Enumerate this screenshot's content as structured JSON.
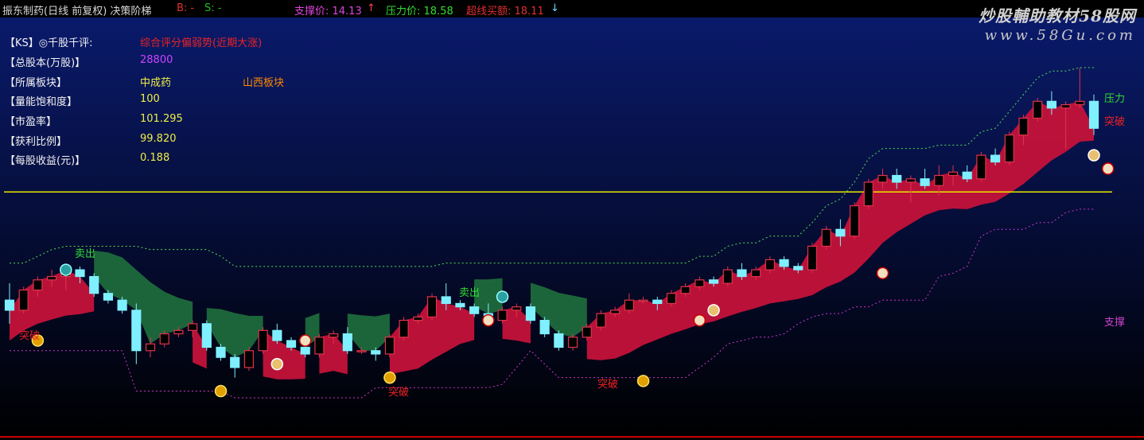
{
  "header": {
    "title": "振东制药(日线 前复权) 决策阶梯",
    "b_label": "B: -",
    "s_label": "S: -",
    "support": "支撑价: 14.13",
    "resistance": "压力价: 18.58",
    "breakout": "超线买额: 18.11",
    "up_arrow": "↑",
    "down_arrow": "↓"
  },
  "watermark": {
    "line1": "炒股輔助教材58股网",
    "line2": "www.58Gu.com"
  },
  "info": {
    "rows": [
      {
        "label": "【KS】◎千股千评:",
        "value": "综合评分偏弱势(近期大涨)",
        "extra": ""
      },
      {
        "label": "【总股本(万股)】",
        "value": "28800",
        "extra": ""
      },
      {
        "label": "【所属板块】",
        "value": "中成药",
        "extra": "山西板块"
      },
      {
        "label": "【量能饱和度】",
        "value": "100",
        "extra": ""
      },
      {
        "label": "【市盈率】",
        "value": "101.295",
        "extra": ""
      },
      {
        "label": "【获利比例】",
        "value": "99.820",
        "extra": ""
      },
      {
        "label": "【每股收益(元)】",
        "value": "0.188",
        "extra": ""
      }
    ]
  },
  "annotations": {
    "sell": "卖出",
    "support": "支撑",
    "resistance": "压力",
    "surge": "突破"
  },
  "colors": {
    "background_top": "#0a1a6b",
    "background_bottom": "#000000",
    "up_candle": "#e0334a",
    "down_candle": "#7ff0ff",
    "bull_band": "#c4123a",
    "bear_band": "#1e6a3c",
    "level_line": "#e8e800",
    "resist_dots": "#55dd55",
    "support_dots": "#cc33cc"
  },
  "chart_data": {
    "type": "candlestick",
    "candles": [
      [
        14.9,
        15.4,
        14.2,
        14.6
      ],
      [
        14.6,
        15.3,
        14.5,
        15.2
      ],
      [
        15.2,
        15.6,
        15.0,
        15.5
      ],
      [
        15.5,
        15.8,
        15.3,
        15.6
      ],
      [
        15.6,
        15.9,
        15.2,
        15.8
      ],
      [
        15.8,
        15.9,
        15.4,
        15.6
      ],
      [
        15.6,
        15.7,
        15.0,
        15.1
      ],
      [
        15.1,
        15.2,
        14.8,
        14.9
      ],
      [
        14.9,
        15.0,
        14.5,
        14.6
      ],
      [
        14.6,
        14.8,
        13.0,
        13.4
      ],
      [
        13.4,
        13.8,
        13.2,
        13.6
      ],
      [
        13.6,
        14.0,
        13.5,
        13.9
      ],
      [
        13.9,
        14.1,
        13.8,
        14.0
      ],
      [
        14.0,
        14.3,
        13.8,
        14.2
      ],
      [
        14.2,
        14.3,
        13.4,
        13.5
      ],
      [
        13.5,
        13.6,
        13.1,
        13.2
      ],
      [
        13.2,
        13.3,
        12.6,
        12.9
      ],
      [
        12.9,
        13.5,
        12.8,
        13.4
      ],
      [
        13.4,
        14.1,
        13.3,
        14.0
      ],
      [
        14.0,
        14.2,
        13.6,
        13.7
      ],
      [
        13.7,
        13.8,
        13.4,
        13.5
      ],
      [
        13.5,
        13.6,
        13.2,
        13.3
      ],
      [
        13.3,
        13.9,
        13.2,
        13.8
      ],
      [
        13.8,
        14.0,
        13.6,
        13.9
      ],
      [
        13.9,
        14.1,
        13.3,
        13.4
      ],
      [
        13.4,
        13.5,
        13.3,
        13.4
      ],
      [
        13.4,
        13.5,
        13.1,
        13.3
      ],
      [
        13.3,
        13.9,
        13.2,
        13.8
      ],
      [
        13.8,
        14.4,
        13.7,
        14.3
      ],
      [
        14.3,
        14.5,
        14.2,
        14.4
      ],
      [
        14.4,
        15.1,
        14.3,
        15.0
      ],
      [
        15.0,
        15.4,
        14.6,
        14.8
      ],
      [
        14.8,
        14.9,
        14.6,
        14.7
      ],
      [
        14.7,
        14.8,
        14.4,
        14.5
      ],
      [
        14.5,
        14.8,
        14.2,
        14.3
      ],
      [
        14.3,
        14.7,
        14.2,
        14.6
      ],
      [
        14.6,
        14.8,
        14.4,
        14.7
      ],
      [
        14.7,
        14.8,
        14.2,
        14.3
      ],
      [
        14.3,
        14.4,
        13.8,
        13.9
      ],
      [
        13.9,
        14.0,
        13.4,
        13.5
      ],
      [
        13.5,
        13.9,
        13.4,
        13.8
      ],
      [
        13.8,
        14.2,
        13.7,
        14.1
      ],
      [
        14.1,
        14.6,
        14.0,
        14.5
      ],
      [
        14.5,
        14.7,
        14.4,
        14.6
      ],
      [
        14.6,
        15.1,
        14.5,
        14.9
      ],
      [
        14.9,
        15.0,
        14.8,
        14.9
      ],
      [
        14.9,
        15.0,
        14.6,
        14.8
      ],
      [
        14.8,
        15.2,
        14.7,
        15.1
      ],
      [
        15.1,
        15.4,
        15.0,
        15.3
      ],
      [
        15.3,
        15.6,
        15.2,
        15.5
      ],
      [
        15.5,
        15.6,
        15.3,
        15.4
      ],
      [
        15.4,
        15.9,
        15.3,
        15.8
      ],
      [
        15.8,
        16.0,
        15.5,
        15.6
      ],
      [
        15.6,
        15.9,
        15.5,
        15.8
      ],
      [
        15.8,
        16.2,
        15.7,
        16.1
      ],
      [
        16.1,
        16.2,
        15.8,
        15.9
      ],
      [
        15.9,
        16.0,
        15.7,
        15.8
      ],
      [
        15.8,
        16.6,
        15.7,
        16.5
      ],
      [
        16.5,
        17.1,
        16.4,
        17.0
      ],
      [
        17.0,
        17.3,
        16.5,
        16.8
      ],
      [
        16.8,
        17.8,
        16.7,
        17.7
      ],
      [
        17.7,
        18.5,
        17.6,
        18.4
      ],
      [
        18.4,
        18.8,
        18.2,
        18.6
      ],
      [
        18.6,
        18.8,
        18.2,
        18.4
      ],
      [
        18.4,
        18.6,
        17.8,
        18.5
      ],
      [
        18.5,
        18.8,
        18.2,
        18.3
      ],
      [
        18.3,
        18.9,
        18.0,
        18.6
      ],
      [
        18.6,
        18.9,
        18.3,
        18.7
      ],
      [
        18.7,
        18.9,
        18.4,
        18.5
      ],
      [
        18.5,
        19.3,
        18.4,
        19.2
      ],
      [
        19.2,
        19.4,
        18.9,
        19.0
      ],
      [
        19.0,
        19.9,
        18.9,
        19.8
      ],
      [
        19.8,
        20.4,
        19.5,
        20.3
      ],
      [
        20.3,
        20.9,
        20.2,
        20.8
      ],
      [
        20.8,
        21.1,
        20.4,
        20.6
      ],
      [
        20.6,
        20.8,
        19.4,
        20.7
      ],
      [
        20.7,
        21.8,
        20.6,
        20.8
      ],
      [
        20.8,
        21.0,
        19.8,
        20.0
      ]
    ],
    "levels": {
      "support": 14.13,
      "resistance": 18.58,
      "breakout": 18.11
    },
    "ylim": [
      12.0,
      21.8
    ]
  }
}
